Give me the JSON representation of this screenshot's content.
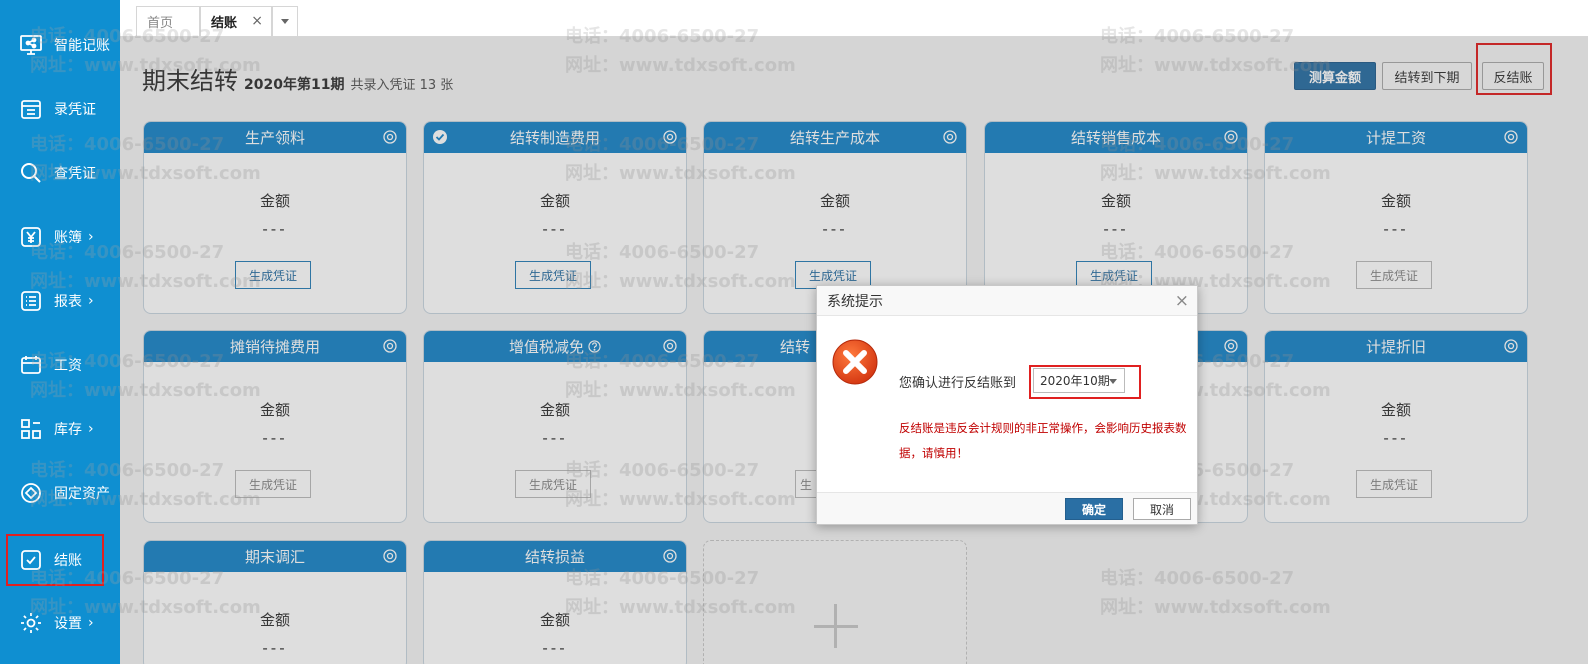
{
  "sidebar": {
    "items": [
      {
        "label": "智能记账",
        "icon": "presentation-icon",
        "arrow": ""
      },
      {
        "label": "录凭证",
        "icon": "voucher-entry-icon",
        "arrow": ""
      },
      {
        "label": "查凭证",
        "icon": "search-icon",
        "arrow": ""
      },
      {
        "label": "账簿",
        "icon": "yen-icon",
        "arrow": "›"
      },
      {
        "label": "报表",
        "icon": "list-icon",
        "arrow": "›"
      },
      {
        "label": "工资",
        "icon": "wallet-icon",
        "arrow": ""
      },
      {
        "label": "库存",
        "icon": "grid-icon",
        "arrow": "›"
      },
      {
        "label": "固定资产",
        "icon": "diamond-icon",
        "arrow": ""
      },
      {
        "label": "结账",
        "icon": "checkbox-icon",
        "arrow": ""
      },
      {
        "label": "设置",
        "icon": "gear-icon",
        "arrow": "›"
      }
    ]
  },
  "tabs": {
    "home": "首页",
    "active": "结账",
    "close": "×"
  },
  "header": {
    "title": "期末结转",
    "period": "2020年第11期",
    "voucher_count": "共录入凭证 13 张",
    "btn_calc": "测算金额",
    "btn_next": "结转到下期",
    "btn_reverse": "反结账"
  },
  "cards": [
    {
      "title": "生产领料",
      "amount_label": "金额",
      "amount": "---",
      "button": "生成凭证",
      "checked": false
    },
    {
      "title": "结转制造费用",
      "amount_label": "金额",
      "amount": "---",
      "button": "生成凭证",
      "checked": true
    },
    {
      "title": "结转生产成本",
      "amount_label": "金额",
      "amount": "---",
      "button": "生成凭证",
      "checked": false
    },
    {
      "title": "结转销售成本",
      "amount_label": "金额",
      "amount": "---",
      "button": "生成凭证",
      "checked": false
    },
    {
      "title": "计提工资",
      "amount_label": "金额",
      "amount": "---",
      "button": "生成凭证",
      "checked": false
    },
    {
      "title": "摊销待摊费用",
      "amount_label": "金额",
      "amount": "---",
      "button": "生成凭证",
      "checked": false
    },
    {
      "title": "增值税减免",
      "amount_label": "金额",
      "amount": "---",
      "button": "生成凭证",
      "checked": false,
      "help": true
    },
    {
      "title": "结转",
      "amount_label": "",
      "amount": "",
      "button": "生",
      "checked": false
    },
    {
      "title": "",
      "amount_label": "",
      "amount": "",
      "button": "",
      "checked": false
    },
    {
      "title": "计提折旧",
      "amount_label": "金额",
      "amount": "---",
      "button": "生成凭证",
      "checked": false
    },
    {
      "title": "期末调汇",
      "amount_label": "金额",
      "amount": "---",
      "button": "",
      "checked": false
    },
    {
      "title": "结转损益",
      "amount_label": "金额",
      "amount": "---",
      "button": "",
      "checked": false
    }
  ],
  "dialog": {
    "title": "系统提示",
    "close": "×",
    "message": "您确认进行反结账到",
    "selected_period": "2020年10期",
    "warning": "反结账是违反会计规则的非正常操作，会影响历史报表数据，请慎用！",
    "ok": "确定",
    "cancel": "取消"
  },
  "watermark": {
    "phone": "电话：4006-6500-27",
    "site": "网址：www.tdxsoft.com"
  },
  "colors": {
    "sidebar": "#0f8fd1",
    "card_header": "#1c86c8",
    "primary_button": "#2a6fa4",
    "highlight_red": "#e02020",
    "warning_text": "#c00000"
  }
}
